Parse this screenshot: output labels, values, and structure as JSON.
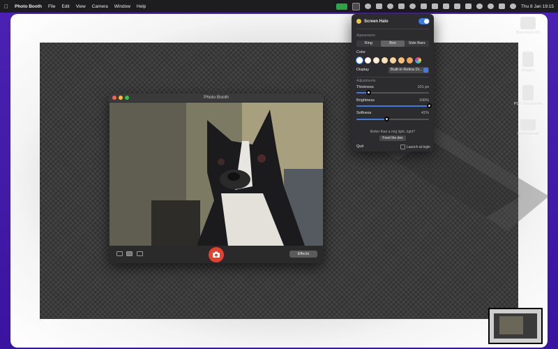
{
  "menubar": {
    "app_name": "Photo Booth",
    "menus": [
      "File",
      "Edit",
      "View",
      "Camera",
      "Window",
      "Help"
    ],
    "clock": "Thu 8 Jan  19:15"
  },
  "desktop": {
    "icons": [
      {
        "label": "Macintosh HD",
        "icon": "drive-icon"
      },
      {
        "label": "Images",
        "icon": "folder-icon"
      },
      {
        "label": "PDF Documents",
        "icon": "pdf-icon"
      },
      {
        "label": "Screenshots",
        "icon": "screenshot-icon"
      }
    ]
  },
  "photobooth": {
    "title": "Photo Booth",
    "effects_label": "Effects"
  },
  "halo_panel": {
    "title": "Screen Halo",
    "enabled": true,
    "appearance_label": "Appearance",
    "segments": [
      "Ring",
      "Box",
      "Side Bars"
    ],
    "selected_segment": "Box",
    "color_label": "Color",
    "swatches": [
      "#ffffff",
      "#fff8ec",
      "#fbeed3",
      "#f9e2b6",
      "#f7d397",
      "#f4c07a",
      "#f0a65c"
    ],
    "display_label": "Display",
    "display_value": "Built-in Retina Di...",
    "adjustments_label": "Adjustments",
    "thickness": {
      "label": "Thickness",
      "value": "101 px",
      "level": 0.16
    },
    "brightness": {
      "label": "Brightness",
      "value": "100%",
      "level": 1.0
    },
    "softness": {
      "label": "Softness",
      "value": "41%",
      "level": 0.41
    },
    "promo_text": "Better than a ring light, right?",
    "feed_label": "Feed the dev",
    "quit_label": "Quit",
    "launch_label": "Launch at login"
  },
  "colors": {
    "accent": "#3f7be8",
    "shutter": "#e8402f",
    "facetime_green": "#2fc04a"
  }
}
